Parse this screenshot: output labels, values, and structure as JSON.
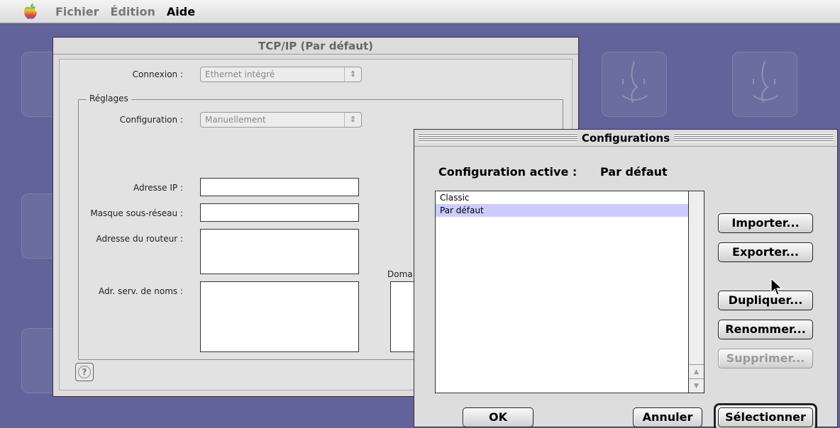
{
  "menubar": {
    "items": [
      "Fichier",
      "Édition",
      "Aide"
    ],
    "active_index": 2
  },
  "tcp_window": {
    "title": "TCP/IP (Par défaut)",
    "connexion_label": "Connexion :",
    "connexion_value": "Ethernet intégré",
    "group_title": "Réglages",
    "configuration_label": "Configuration :",
    "configuration_value": "Manuellement",
    "ip_label": "Adresse IP :",
    "mask_label": "Masque sous-réseau :",
    "router_label": "Adresse du routeur :",
    "dns_label": "Adr. serv. de noms :",
    "domain_label": "Doma",
    "help_glyph": "?"
  },
  "conf_window": {
    "title": "Configurations",
    "active_label": "Configuration active :",
    "active_value": "Par défaut",
    "list_items": [
      "Classic",
      "Par défaut"
    ],
    "selected_index": 1,
    "buttons": {
      "import": "Importer...",
      "export": "Exporter...",
      "duplicate": "Dupliquer...",
      "rename": "Renommer...",
      "delete": "Supprimer...",
      "ok": "OK",
      "cancel": "Annuler",
      "select": "Sélectionner"
    }
  },
  "colors": {
    "desktop": "#62639a",
    "selection": "#ccccff",
    "window": "#dddddd"
  }
}
